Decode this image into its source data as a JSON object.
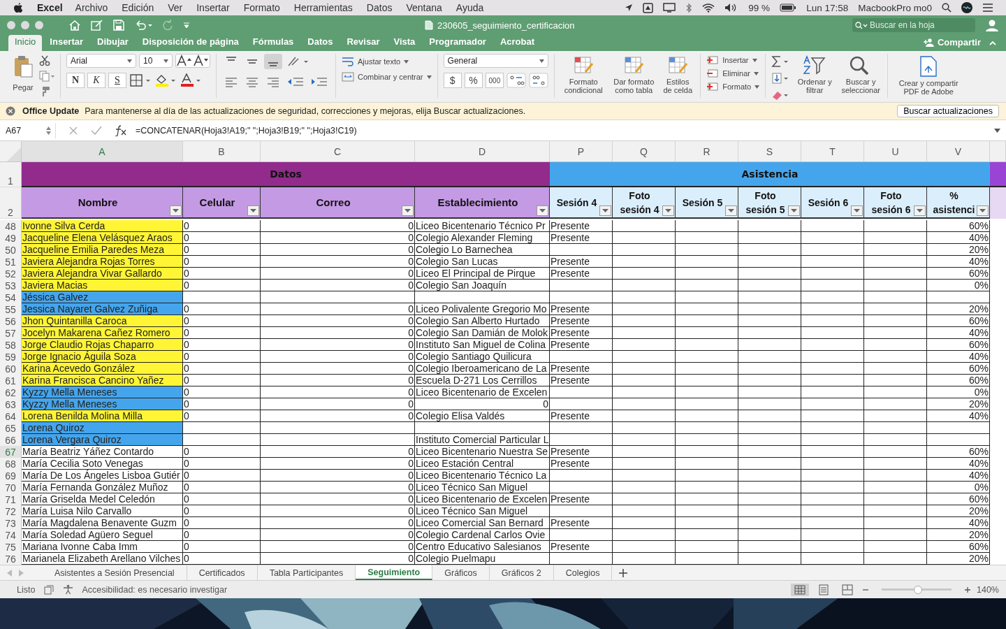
{
  "menu_bar": {
    "app": "Excel",
    "items": [
      "Archivo",
      "Edición",
      "Ver",
      "Insertar",
      "Formato",
      "Herramientas",
      "Datos",
      "Ventana",
      "Ayuda"
    ],
    "battery": "99 %",
    "clock": "Lun 17:58",
    "user": "MacbookPro mo0"
  },
  "window": {
    "title": "230605_seguimiento_certificacion",
    "search_placeholder": "Buscar en la hoja",
    "share": "Compartir"
  },
  "ribbon_tabs": [
    {
      "label": "Inicio",
      "selected": true
    },
    {
      "label": "Insertar",
      "selected": false
    },
    {
      "label": "Dibujar",
      "selected": false
    },
    {
      "label": "Disposición de página",
      "selected": false
    },
    {
      "label": "Fórmulas",
      "selected": false
    },
    {
      "label": "Datos",
      "selected": false
    },
    {
      "label": "Revisar",
      "selected": false
    },
    {
      "label": "Vista",
      "selected": false
    },
    {
      "label": "Programador",
      "selected": false
    },
    {
      "label": "Acrobat",
      "selected": false
    }
  ],
  "ribbon": {
    "paste": "Pegar",
    "font": "Arial",
    "size": "10",
    "style_buttons": [
      "N",
      "K",
      "S"
    ],
    "wrap": "Ajustar texto",
    "merge": "Combinar y centrar",
    "number_format": "General",
    "number_buttons": [
      "$",
      "%",
      "000"
    ],
    "styles": [
      "Formato condicional",
      "Dar formato como tabla",
      "Estilos de celda"
    ],
    "cells": [
      "Insertar",
      "Eliminar",
      "Formato"
    ],
    "sort": "Ordenar y filtrar",
    "find": "Buscar y seleccionar",
    "pdf": "Crear y compartir PDF de Adobe"
  },
  "update_bar": {
    "title": "Office Update",
    "message": "Para mantenerse al día de las actualizaciones de seguridad, correcciones y mejoras, elija Buscar actualizaciones.",
    "button": "Buscar actualizaciones"
  },
  "formula_bar": {
    "cell": "A67",
    "formula": "=CONCATENAR(Hoja3!A19;\" \";Hoja3!B19;\" \";Hoja3!C19)"
  },
  "columns": [
    {
      "letter": "A",
      "selected": true
    },
    {
      "letter": "B",
      "selected": false
    },
    {
      "letter": "C",
      "selected": false
    },
    {
      "letter": "D",
      "selected": false
    },
    {
      "letter": "P",
      "selected": false
    },
    {
      "letter": "Q",
      "selected": false
    },
    {
      "letter": "R",
      "selected": false
    },
    {
      "letter": "S",
      "selected": false
    },
    {
      "letter": "T",
      "selected": false
    },
    {
      "letter": "U",
      "selected": false
    },
    {
      "letter": "V",
      "selected": false
    }
  ],
  "groups": [
    {
      "label": "Datos",
      "color": "#922b8c"
    },
    {
      "label": "Asistencia",
      "color": "#45a5ec"
    }
  ],
  "header_rows": [
    "1",
    "2"
  ],
  "fields": [
    "Nombre",
    "Celular",
    "Correo",
    "Establecimiento",
    "Sesión 4",
    "Foto sesión 4",
    "Sesión 5",
    "Foto sesión 5",
    "Sesión 6",
    "Foto sesión 6",
    "% asistenci"
  ],
  "rows": [
    {
      "n": "48",
      "selected": false,
      "color": "#fff534",
      "name": "Ivonne Silva Cerda",
      "celular": "0",
      "correo": "0",
      "establecimiento": "Liceo Bicentenario Técnico Pr",
      "sesion_4": "Presente",
      "asistencia": "60%"
    },
    {
      "n": "49",
      "selected": false,
      "color": "#fff534",
      "name": "Jacqueline Elena Velásquez Araos",
      "celular": "0",
      "correo": "0",
      "establecimiento": "Colegio Alexander Fleming",
      "sesion_4": "Presente",
      "asistencia": "40%"
    },
    {
      "n": "50",
      "selected": false,
      "color": "#fff534",
      "name": "Jacqueline Emilia Paredes Meza",
      "celular": "0",
      "correo": "0",
      "establecimiento": "Colegio Lo Barnechea",
      "asistencia": "20%"
    },
    {
      "n": "51",
      "selected": false,
      "color": "#fff534",
      "name": "Javiera Alejandra Rojas Torres",
      "celular": "0",
      "correo": "0",
      "establecimiento": "Colegio San Lucas",
      "sesion_4": "Presente",
      "asistencia": "40%"
    },
    {
      "n": "52",
      "selected": false,
      "color": "#fff534",
      "name": "Javiera Alejandra Vivar Gallardo",
      "celular": "0",
      "correo": "0",
      "establecimiento": "Liceo El Principal de Pirque",
      "sesion_4": "Presente",
      "asistencia": "60%"
    },
    {
      "n": "53",
      "selected": false,
      "color": "#fff534",
      "name": "Javiera Macias",
      "celular": "0",
      "correo": "0",
      "establecimiento": "Colegio San Joaquín",
      "asistencia": "0%"
    },
    {
      "n": "54",
      "selected": false,
      "color": "#45a5ec",
      "name": "Jéssica Galvez"
    },
    {
      "n": "55",
      "selected": false,
      "color": "#45a5ec",
      "name": "Jessica Nayaret Galvez Zuñiga",
      "celular": "0",
      "correo": "0",
      "establecimiento": "Liceo Polivalente Gregorio Mo",
      "sesion_4": "Presente",
      "asistencia": "20%"
    },
    {
      "n": "56",
      "selected": false,
      "color": "#fff534",
      "name": "Jhon Quintanilla Caroca",
      "celular": "0",
      "correo": "0",
      "establecimiento": "Colegio San Alberto Hurtado",
      "sesion_4": "Presente",
      "asistencia": "60%"
    },
    {
      "n": "57",
      "selected": false,
      "color": "#fff534",
      "name": "Jocelyn Makarena Cañez Romero",
      "celular": "0",
      "correo": "0",
      "establecimiento": "Colegio San Damián de Molok",
      "sesion_4": "Presente",
      "asistencia": "40%"
    },
    {
      "n": "58",
      "selected": false,
      "color": "#fff534",
      "name": "Jorge Claudio Rojas Chaparro",
      "celular": "0",
      "correo": "0",
      "establecimiento": "Instituto San Miguel de Colina",
      "sesion_4": "Presente",
      "asistencia": "60%"
    },
    {
      "n": "59",
      "selected": false,
      "color": "#fff534",
      "name": "Jorge Ignacio Águila Soza",
      "celular": "0",
      "correo": "0",
      "establecimiento": "Colegio Santiago Quilicura",
      "asistencia": "40%"
    },
    {
      "n": "60",
      "selected": false,
      "color": "#fff534",
      "name": "Karina Acevedo González",
      "celular": "0",
      "correo": "0",
      "establecimiento": "Colegio Iberoamericano de La",
      "sesion_4": "Presente",
      "asistencia": "60%"
    },
    {
      "n": "61",
      "selected": false,
      "color": "#fff534",
      "name": "Karina Francisca Cancino Yañez",
      "celular": "0",
      "correo": "0",
      "establecimiento": "Escuela D-271 Los Cerrillos",
      "sesion_4": "Presente",
      "asistencia": "60%"
    },
    {
      "n": "62",
      "selected": false,
      "color": "#45a5ec",
      "name": "Kyzzy Mella Meneses",
      "celular": "0",
      "correo": "0",
      "establecimiento": "Liceo Bicentenario de Excelen",
      "asistencia": "0%"
    },
    {
      "n": "63",
      "selected": false,
      "color": "#45a5ec",
      "name": "Kyzzy Mella Meneses",
      "celular": "0",
      "correo": "0",
      "establecimiento_number": "0",
      "asistencia": "20%"
    },
    {
      "n": "64",
      "selected": false,
      "color": "#fff534",
      "name": "Lorena Benilda Molina Milla",
      "celular": "0",
      "correo": "0",
      "establecimiento": "Colegio Elisa Valdés",
      "sesion_4": "Presente",
      "asistencia": "40%"
    },
    {
      "n": "65",
      "selected": false,
      "color": "#45a5ec",
      "name": "Lorena Quiroz"
    },
    {
      "n": "66",
      "selected": false,
      "color": "#45a5ec",
      "name": "Lorena Vergara Quiroz",
      "establecimiento": "Instituto Comercial Particular L"
    },
    {
      "n": "67",
      "selected": true,
      "name": "María Beatriz Yáñez Contardo",
      "celular": "0",
      "correo": "0",
      "establecimiento": "Liceo Bicentenario Nuestra Se",
      "sesion_4": "Presente",
      "asistencia": "60%"
    },
    {
      "n": "68",
      "selected": false,
      "name": "María Cecilia Soto Venegas",
      "celular": "0",
      "correo": "0",
      "establecimiento": "Liceo Estación Central",
      "sesion_4": "Presente",
      "asistencia": "40%"
    },
    {
      "n": "69",
      "selected": false,
      "name": "María De Los Ángeles Lisboa Gutiér",
      "celular": "0",
      "correo": "0",
      "establecimiento": "Liceo Bicentenario Técnico La",
      "asistencia": "40%"
    },
    {
      "n": "70",
      "selected": false,
      "name": "María Fernanda González Muñoz",
      "celular": "0",
      "correo": "0",
      "establecimiento": "Liceo Técnico San Miguel",
      "asistencia": "0%"
    },
    {
      "n": "71",
      "selected": false,
      "name": "María Griselda Medel Celedón",
      "celular": "0",
      "correo": "0",
      "establecimiento": "Liceo Bicentenario de Excelen",
      "sesion_4": "Presente",
      "asistencia": "60%"
    },
    {
      "n": "72",
      "selected": false,
      "name": "María Luisa Nilo Carvallo",
      "celular": "0",
      "correo": "0",
      "establecimiento": "Liceo Técnico San Miguel",
      "asistencia": "20%"
    },
    {
      "n": "73",
      "selected": false,
      "name": "María Magdalena Benavente Guzm",
      "celular": "0",
      "correo": "0",
      "establecimiento": "Liceo Comercial San Bernard",
      "sesion_4": "Presente",
      "asistencia": "40%"
    },
    {
      "n": "74",
      "selected": false,
      "name": "María Soledad Agüero Seguel",
      "celular": "0",
      "correo": "0",
      "establecimiento": "Colegio Cardenal Carlos Ovie",
      "asistencia": "20%"
    },
    {
      "n": "75",
      "selected": false,
      "name": "Mariana Ivonne Caba Imm",
      "celular": "0",
      "correo": "0",
      "establecimiento": "Centro Educativo Salesianos",
      "sesion_4": "Presente",
      "asistencia": "60%"
    },
    {
      "n": "76",
      "selected": false,
      "name": "Marianela Elizabeth Arellano Vilches",
      "celular": "0",
      "correo": "0",
      "establecimiento": "Colegio Puelmapu",
      "asistencia": "20%"
    }
  ],
  "sheet_tabs": [
    {
      "label": "Asistentes a Sesión Presencial",
      "selected": false
    },
    {
      "label": "Certificados",
      "selected": false
    },
    {
      "label": "Tabla Participantes",
      "selected": false
    },
    {
      "label": "Seguimiento",
      "selected": true
    },
    {
      "label": "Gráficos",
      "selected": false
    },
    {
      "label": "Gráficos 2",
      "selected": false
    },
    {
      "label": "Colegios",
      "selected": false
    }
  ],
  "status_bar": {
    "state": "Listo",
    "accessibility": "Accesibilidad: es necesario investigar",
    "zoom": "140%",
    "zoom_level": {
      "level": 0.52
    }
  }
}
